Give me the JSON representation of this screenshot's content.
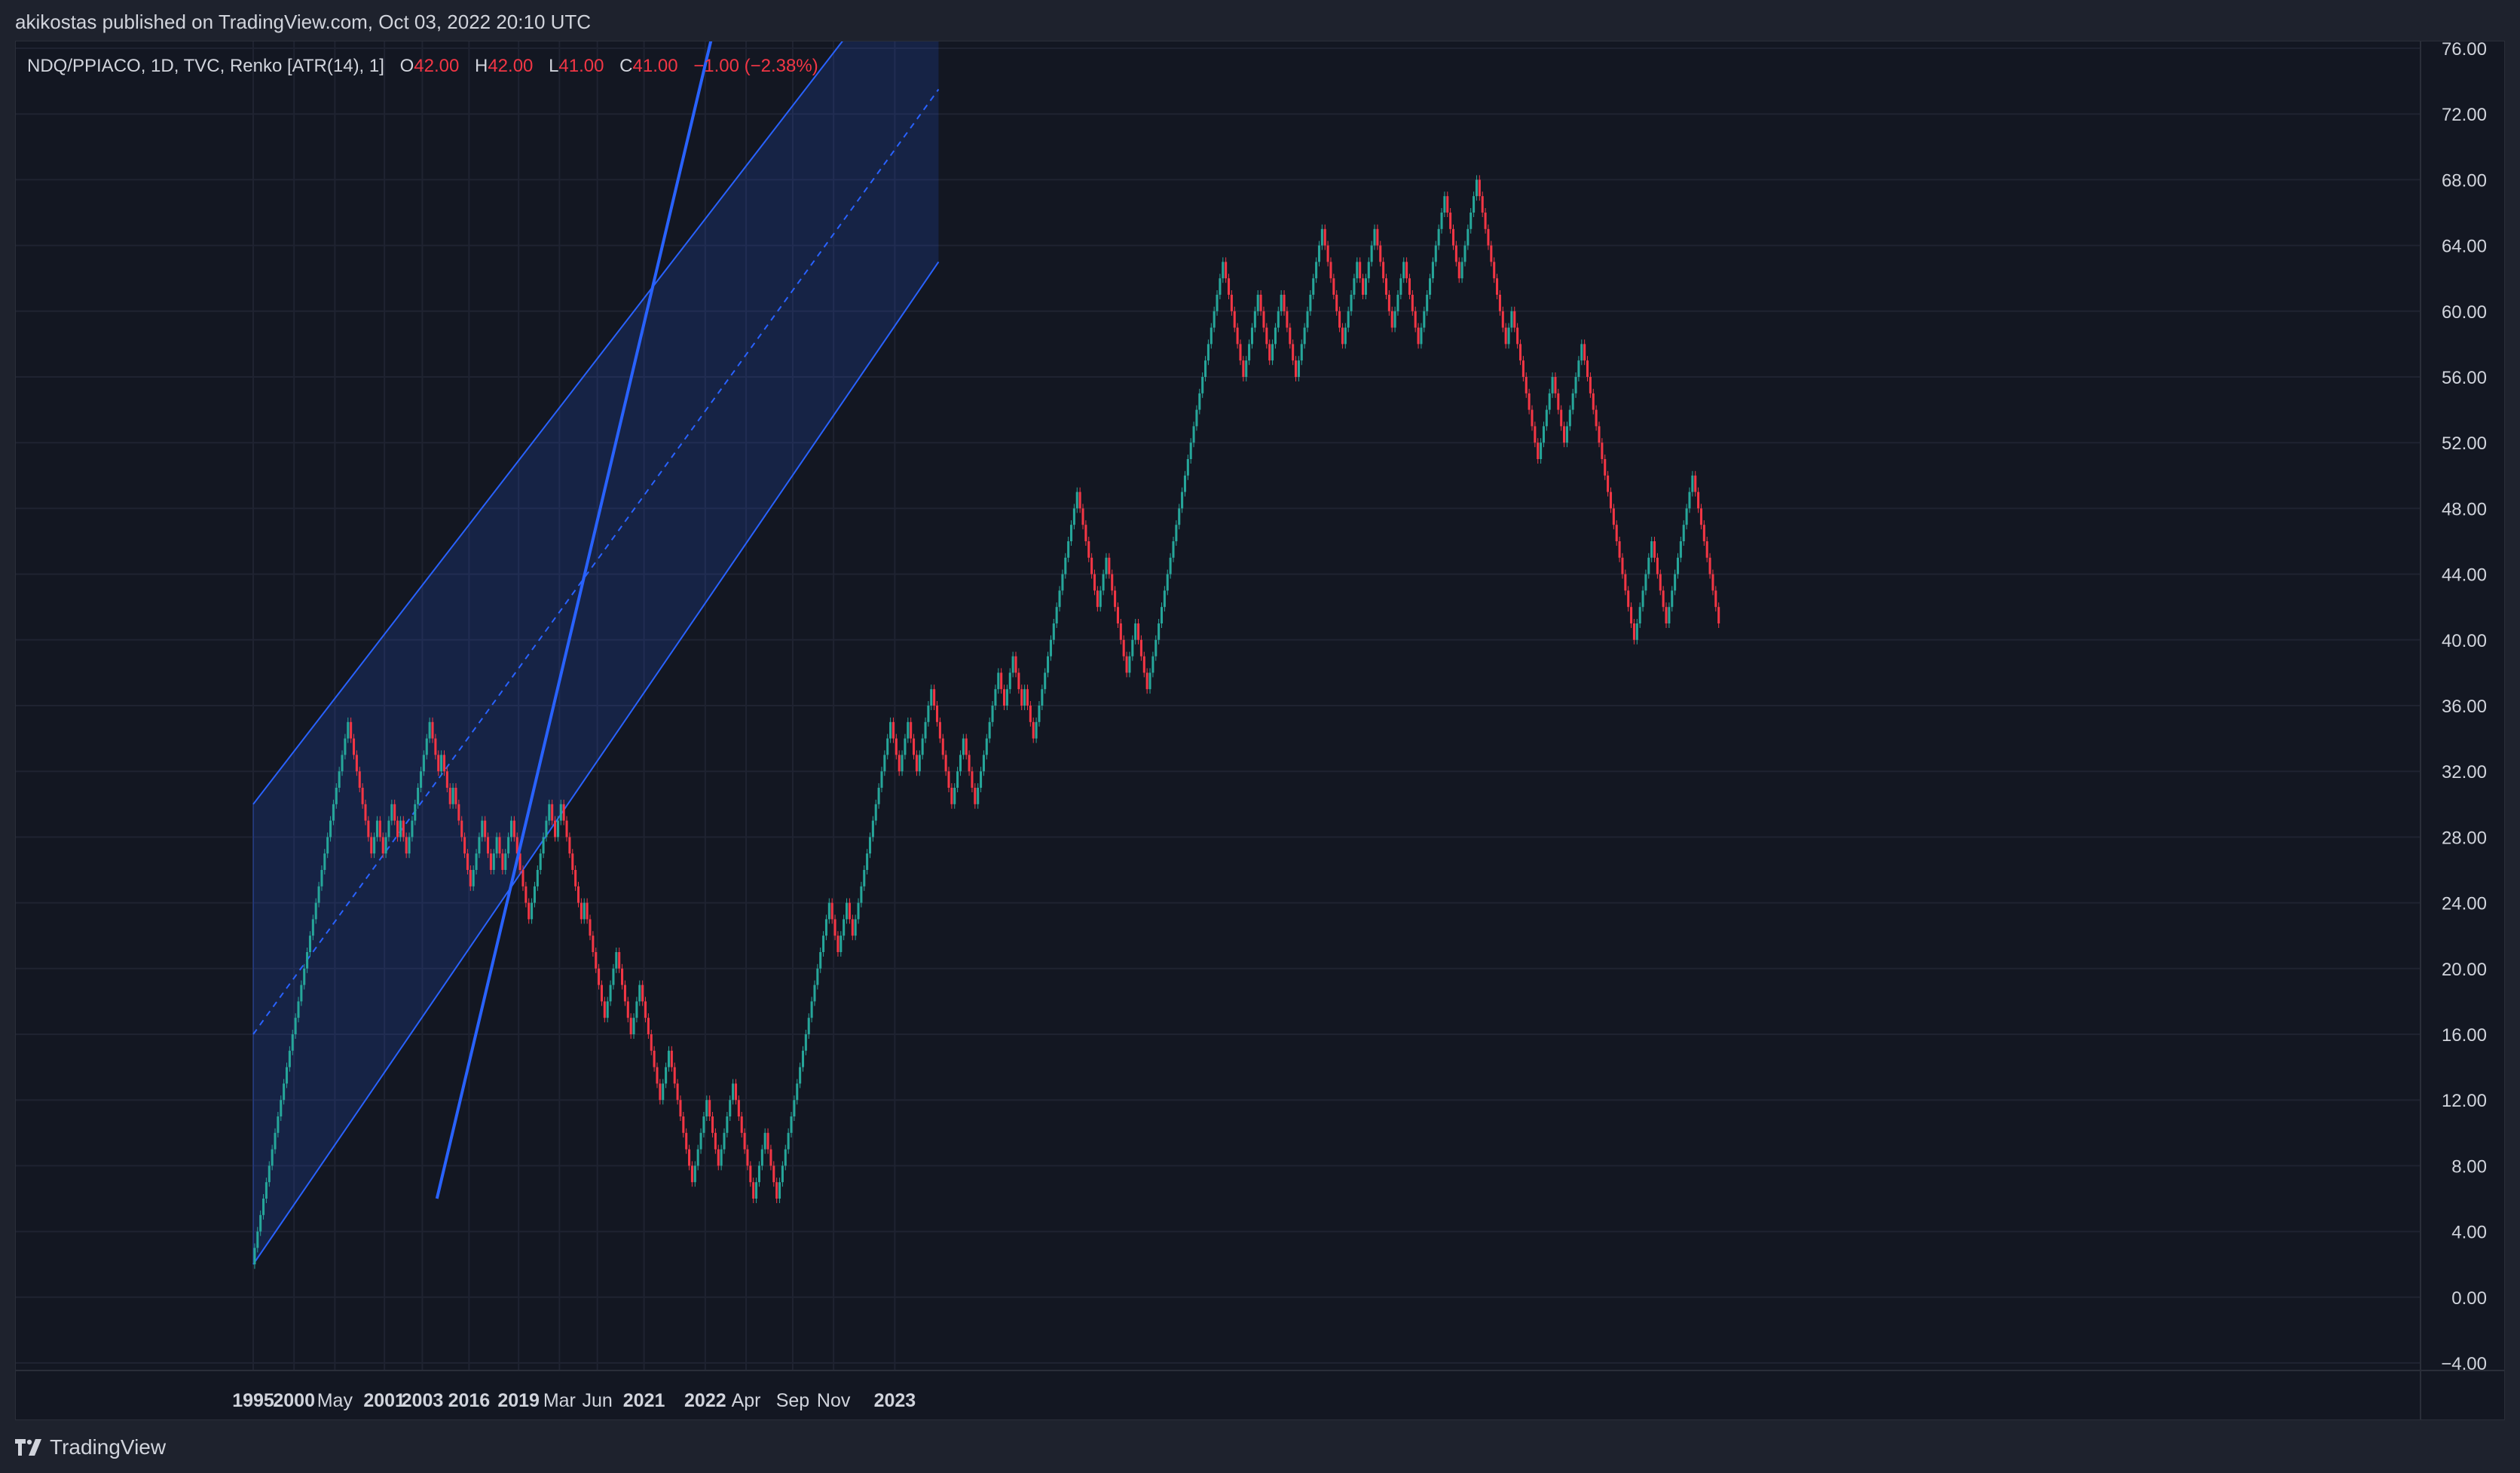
{
  "header": {
    "published": "akikostas published on TradingView.com, Oct 03, 2022 20:10 UTC"
  },
  "legend": {
    "symbol": "NDQ/PPIACO, 1D, TVC, Renko [ATR(14), 1]",
    "o_label": "O",
    "o_value": "42.00",
    "h_label": "H",
    "h_value": "42.00",
    "l_label": "L",
    "l_value": "41.00",
    "c_label": "C",
    "c_value": "41.00",
    "change": "−1.00 (−2.38%)"
  },
  "footer": {
    "brand": "TradingView",
    "logo_icon": "tradingview-logo-icon"
  },
  "colors": {
    "background": "#131722",
    "up": "#26a69a",
    "down": "#f23645",
    "channel_line": "#2962ff",
    "channel_fill": "#2962ff",
    "grid": "#1f2331",
    "axis_text": "#d1d4dc"
  },
  "chart_data": {
    "type": "renko",
    "ylim": [
      -4,
      76
    ],
    "yticks": [
      "76.00",
      "72.00",
      "68.00",
      "64.00",
      "60.00",
      "56.00",
      "52.00",
      "48.00",
      "44.00",
      "40.00",
      "36.00",
      "32.00",
      "28.00",
      "24.00",
      "20.00",
      "16.00",
      "12.00",
      "8.00",
      "4.00",
      "0.00",
      "−4.00"
    ],
    "ytick_values": [
      76,
      72,
      68,
      64,
      60,
      56,
      52,
      48,
      44,
      40,
      36,
      32,
      28,
      24,
      20,
      16,
      12,
      8,
      4,
      0,
      -4
    ],
    "xticks": [
      {
        "label": "1995",
        "bold": true,
        "brick": 0
      },
      {
        "label": "2000",
        "bold": true,
        "brick": 14
      },
      {
        "label": "May",
        "bold": false,
        "brick": 28
      },
      {
        "label": "2001",
        "bold": true,
        "brick": 45
      },
      {
        "label": "2003",
        "bold": true,
        "brick": 58
      },
      {
        "label": "2016",
        "bold": true,
        "brick": 74
      },
      {
        "label": "2019",
        "bold": true,
        "brick": 91
      },
      {
        "label": "Mar",
        "bold": false,
        "brick": 105
      },
      {
        "label": "Jun",
        "bold": false,
        "brick": 118
      },
      {
        "label": "2021",
        "bold": true,
        "brick": 134
      },
      {
        "label": "2022",
        "bold": true,
        "brick": 155
      },
      {
        "label": "Apr",
        "bold": false,
        "brick": 169
      },
      {
        "label": "Sep",
        "bold": false,
        "brick": 185
      },
      {
        "label": "Nov",
        "bold": false,
        "brick": 199
      },
      {
        "label": "2023",
        "bold": true,
        "brick": 220
      }
    ],
    "brick_size": 1,
    "renko_pivots": [
      2,
      35,
      27,
      29,
      27,
      30,
      28,
      29,
      27,
      35,
      32,
      33,
      30,
      31,
      25,
      29,
      26,
      28,
      26,
      29,
      23,
      30,
      28,
      30,
      23,
      24,
      17,
      21,
      16,
      19,
      12,
      15,
      7,
      12,
      8,
      13,
      6,
      10,
      6,
      24,
      21,
      24,
      22,
      35,
      32,
      35,
      32,
      37,
      30,
      34,
      30,
      38,
      36,
      39,
      36,
      37,
      34,
      49,
      42,
      45,
      38,
      41,
      37,
      63,
      56,
      61,
      57,
      61,
      56,
      65,
      58,
      63,
      61,
      65,
      59,
      63,
      58,
      67,
      62,
      68,
      58,
      60,
      51,
      56,
      52,
      58,
      40,
      46,
      41,
      50,
      41
    ],
    "channel": {
      "upper": {
        "x0": 0,
        "y0": 30,
        "x1": 235,
        "y1": 84
      },
      "lower": {
        "x0": 0,
        "y0": 2,
        "x1": 235,
        "y1": 63
      },
      "middle": {
        "x0": 0,
        "y0": 16,
        "x1": 235,
        "y1": 73.5
      },
      "x_end": 235
    },
    "trendline": {
      "x0": 63,
      "y0": 6,
      "x1": 175,
      "y1": 90
    }
  }
}
